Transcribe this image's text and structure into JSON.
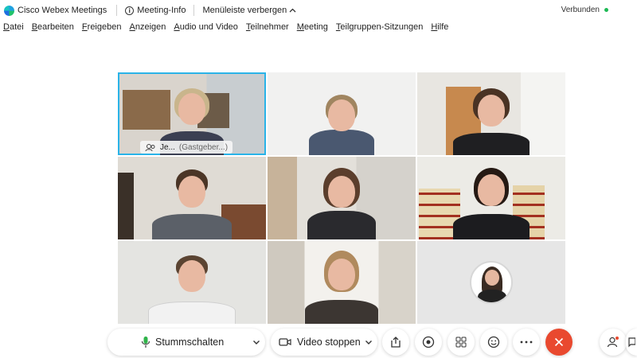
{
  "titlebar": {
    "app_title": "Cisco Webex Meetings",
    "meeting_info": "Meeting-Info",
    "hide_menu": "Menüleiste verbergen",
    "status": "Verbunden"
  },
  "menu": [
    "Datei",
    "Bearbeiten",
    "Freigeben",
    "Anzeigen",
    "Audio und Video",
    "Teilnehmer",
    "Meeting",
    "Teilgruppen-Sitzungen",
    "Hilfe"
  ],
  "video_grid": {
    "active_speaker": {
      "name": "Je...",
      "role": "(Gastgeber...)"
    }
  },
  "controls": {
    "mute_label": "Stummschalten",
    "video_label": "Video stoppen"
  },
  "colors": {
    "accent": "#2ab3e8",
    "end_call": "#e9492f",
    "connected": "#1db954"
  }
}
